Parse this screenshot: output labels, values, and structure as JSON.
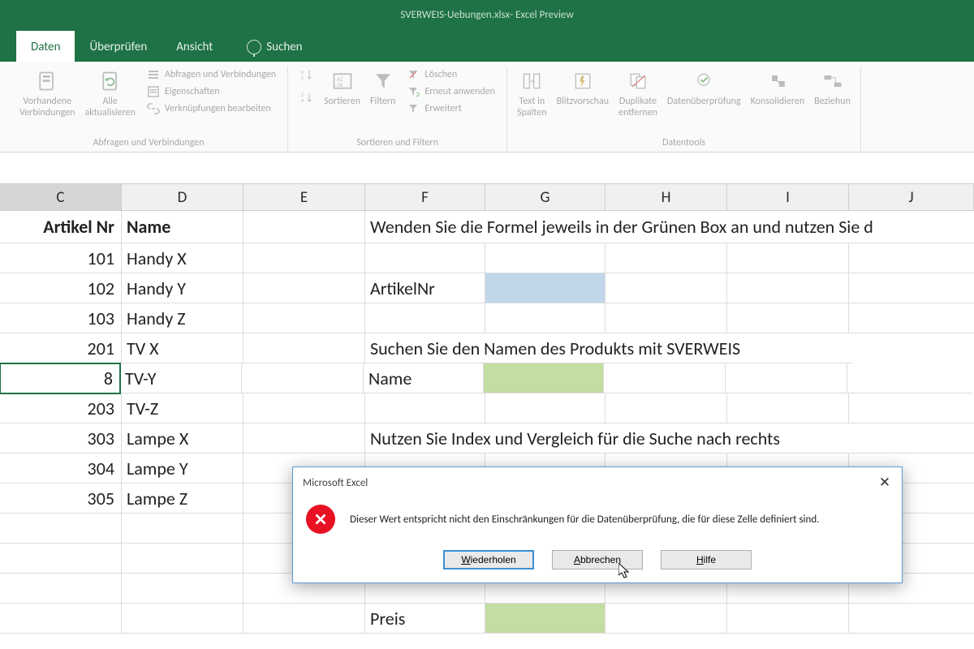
{
  "titlebar": {
    "filename": "SVERWEIS-Uebungen.xlsx",
    "appname": "Excel Preview"
  },
  "tabs": {
    "daten": "Daten",
    "ueberpruefen": "Überprüfen",
    "ansicht": "Ansicht",
    "suchen": "Suchen"
  },
  "ribbon": {
    "vorhandene": "Vorhandene\nVerbindungen",
    "alle": "Alle\naktualisieren",
    "abfragen": "Abfragen und Verbindungen",
    "eigenschaften": "Eigenschaften",
    "verknuepfungen": "Verknüpfungen bearbeiten",
    "grp_abfragen": "Abfragen und Verbindungen",
    "sortieren": "Sortieren",
    "filtern": "Filtern",
    "loeschen": "Löschen",
    "erneut": "Erneut anwenden",
    "erweitert": "Erweitert",
    "grp_sortieren": "Sortieren und Filtern",
    "text_spalten": "Text in\nSpalten",
    "blitzvorschau": "Blitzvorschau",
    "duplikate": "Duplikate\nentfernen",
    "datenueberpruefung": "Datenüberprüfung",
    "konsolidieren": "Konsolidieren",
    "beziehungen": "Beziehun",
    "grp_datentools": "Datentools"
  },
  "cols": [
    "C",
    "D",
    "E",
    "F",
    "G",
    "H",
    "I",
    "J"
  ],
  "widths": [
    150,
    150,
    150,
    148,
    148,
    150,
    150,
    154
  ],
  "sheet": {
    "headers": {
      "artikel": "Artikel Nr",
      "name": "Name"
    },
    "instr1": "Wenden Sie die Formel jeweils in der Grünen Box an und nutzen Sie d",
    "artikelnr_lbl": "ArtikelNr",
    "instr2": "Suchen Sie den Namen des Produkts mit SVERWEIS",
    "name_lbl": "Name",
    "instr3": "Nutzen Sie Index und Vergleich für die Suche nach rechts",
    "preis_lbl": "Preis",
    "rows": [
      {
        "nr": "101",
        "name": "Handy X"
      },
      {
        "nr": "102",
        "name": "Handy Y"
      },
      {
        "nr": "103",
        "name": "Handy Z"
      },
      {
        "nr": "201",
        "name": "TV X"
      },
      {
        "nr": "8",
        "name": "TV-Y"
      },
      {
        "nr": "203",
        "name": "TV-Z"
      },
      {
        "nr": "303",
        "name": "Lampe X"
      },
      {
        "nr": "304",
        "name": "Lampe Y"
      },
      {
        "nr": "305",
        "name": "Lampe Z"
      }
    ]
  },
  "dialog": {
    "title": "Microsoft Excel",
    "message": "Dieser Wert entspricht nicht den Einschränkungen für die Datenüberprüfung, die für diese Zelle definiert sind.",
    "retry": "Wiederholen",
    "cancel": "Abbrechen",
    "help": "Hilfe"
  }
}
